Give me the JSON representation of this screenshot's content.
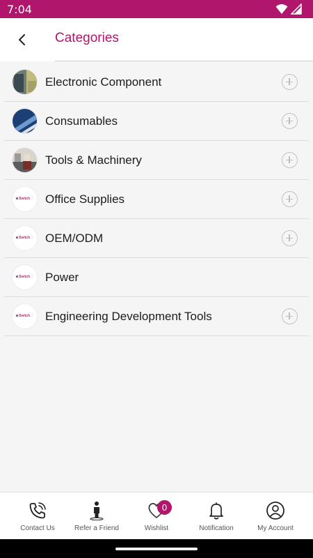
{
  "status_bar": {
    "time": "7:04"
  },
  "header": {
    "title": "Categories"
  },
  "categories": [
    {
      "label": "Electronic Component",
      "image": "photo",
      "expandable": true
    },
    {
      "label": "Consumables",
      "image": "photo",
      "expandable": true
    },
    {
      "label": "Tools & Machinery",
      "image": "photo",
      "expandable": true
    },
    {
      "label": "Office Supplies",
      "image": "logo",
      "expandable": true
    },
    {
      "label": "OEM/ODM",
      "image": "logo",
      "expandable": true
    },
    {
      "label": "Power",
      "image": "logo",
      "expandable": false
    },
    {
      "label": "Engineering Development Tools",
      "image": "logo",
      "expandable": true
    }
  ],
  "logo_placeholder": {
    "text": "Switch"
  },
  "bottom_nav": {
    "items": [
      {
        "label": "Contact Us",
        "icon": "phone-icon"
      },
      {
        "label": "Refer a Friend",
        "icon": "person-icon"
      },
      {
        "label": "Wishlist",
        "icon": "heart-icon"
      },
      {
        "label": "Notification",
        "icon": "bell-icon"
      },
      {
        "label": "My Account",
        "icon": "account-icon"
      }
    ],
    "wishlist_count": "0"
  },
  "colors": {
    "brand": "#b0166c",
    "background": "#f5f5f5"
  }
}
